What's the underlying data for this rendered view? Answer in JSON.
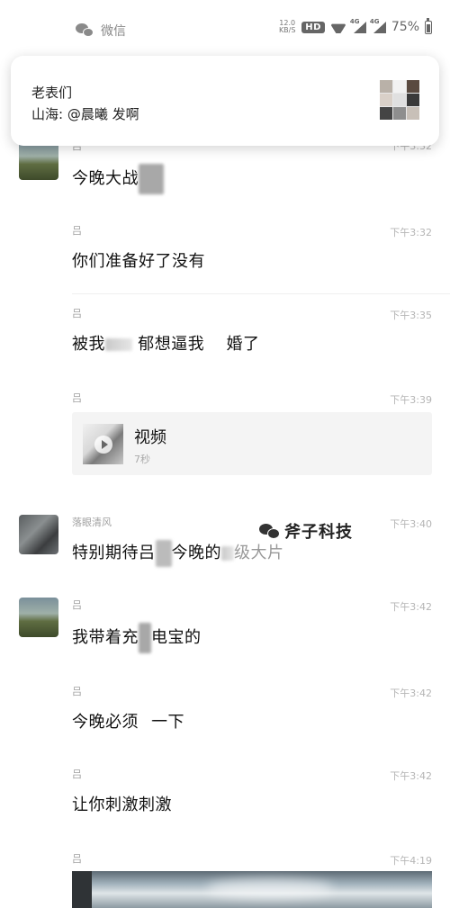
{
  "status_bar": {
    "app_name": "微信",
    "net_speed_value": "12.0",
    "net_speed_unit": "KB/S",
    "hd_label": "HD",
    "signal_1": "4G",
    "signal_2": "4G",
    "battery": "75%"
  },
  "notification": {
    "group_name": "老表们",
    "message": "山海: @晨曦 发啊"
  },
  "messages": [
    {
      "sender": "吕",
      "time": "下午3:32",
      "text_a": "今晚大战",
      "text_b": ""
    },
    {
      "sender": "吕",
      "time": "下午3:32",
      "text": "你们准备好了没有"
    },
    {
      "sender": "吕",
      "time": "下午3:35",
      "text_a": "被我",
      "text_b": "郁想逼我",
      "text_c": "婚了"
    },
    {
      "sender": "吕",
      "time": "下午3:39",
      "video_label": "视频",
      "video_duration": "7秒"
    },
    {
      "sender": "落眼清风",
      "time": "下午3:40",
      "text_a": "特别期待吕",
      "text_b": "今晚的",
      "text_c": "级大片"
    },
    {
      "sender": "吕",
      "time": "下午3:42",
      "text_a": "我带着充",
      "text_b": "电宝的"
    },
    {
      "sender": "吕",
      "time": "下午3:42",
      "text_a": "今晚必须",
      "text_b": "一下"
    },
    {
      "sender": "吕",
      "time": "下午3:42",
      "text": "让你刺激刺激"
    },
    {
      "sender": "吕",
      "time": "下午4:19"
    }
  ],
  "watermark": {
    "text": "斧子科技"
  }
}
